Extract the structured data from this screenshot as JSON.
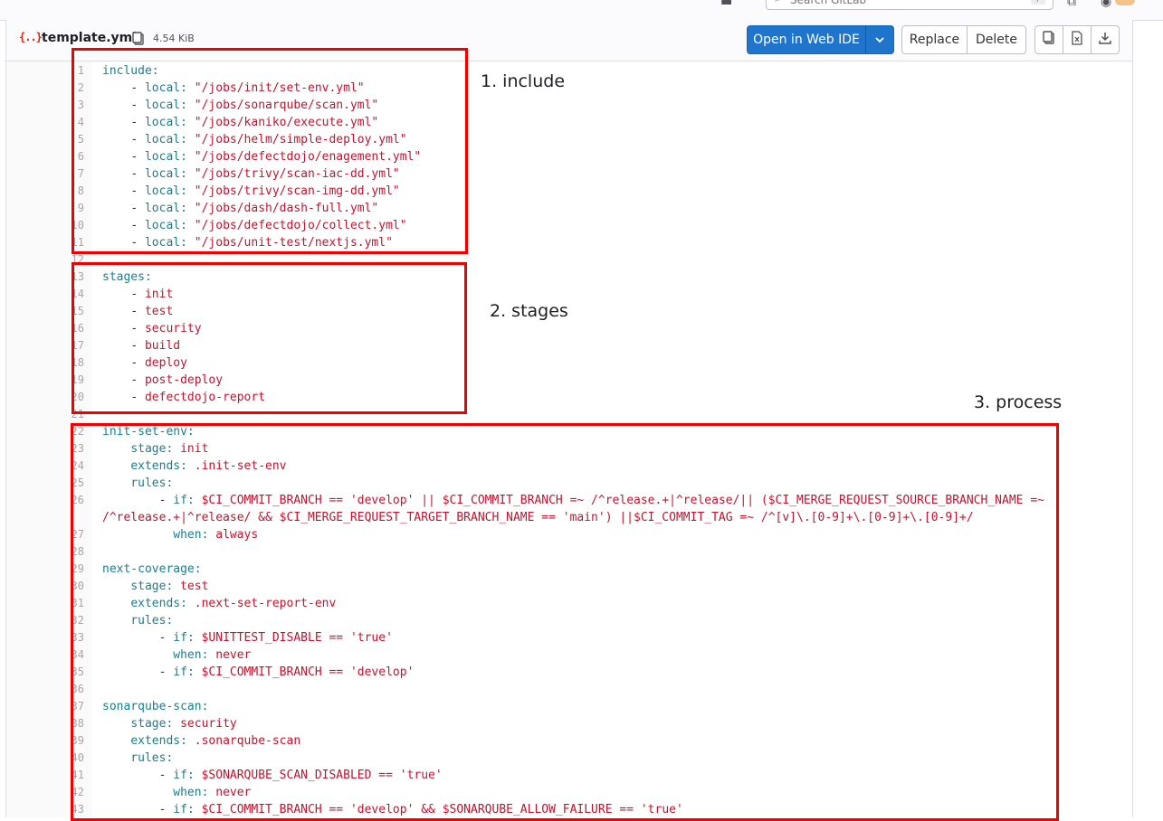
{
  "topbar": {
    "search_placeholder": "Search GitLab",
    "search_kbd": "/"
  },
  "file": {
    "name": "template.yml",
    "size": "4.54 KiB",
    "icon": "yaml-file-icon"
  },
  "actions": {
    "open_ide": "Open in Web IDE",
    "replace": "Replace",
    "delete": "Delete",
    "copy_icon": "copy-icon",
    "raw_icon": "file-raw-icon",
    "download_icon": "download-icon"
  },
  "annotations": {
    "include": "1. include",
    "stages": "2. stages",
    "process": "3. process"
  },
  "code_lines": [
    {
      "n": "1",
      "indent": 0,
      "key": "include",
      "sep": ":",
      "value": ""
    },
    {
      "n": "2",
      "indent": 4,
      "prefix": "- ",
      "key": "local",
      "sep": ": ",
      "value": "\"/jobs/init/set-env.yml\""
    },
    {
      "n": "3",
      "indent": 4,
      "prefix": "- ",
      "key": "local",
      "sep": ": ",
      "value": "\"/jobs/sonarqube/scan.yml\""
    },
    {
      "n": "4",
      "indent": 4,
      "prefix": "- ",
      "key": "local",
      "sep": ": ",
      "value": "\"/jobs/kaniko/execute.yml\""
    },
    {
      "n": "5",
      "indent": 4,
      "prefix": "- ",
      "key": "local",
      "sep": ": ",
      "value": "\"/jobs/helm/simple-deploy.yml\""
    },
    {
      "n": "6",
      "indent": 4,
      "prefix": "- ",
      "key": "local",
      "sep": ": ",
      "value": "\"/jobs/defectdojo/enagement.yml\""
    },
    {
      "n": "7",
      "indent": 4,
      "prefix": "- ",
      "key": "local",
      "sep": ": ",
      "value": "\"/jobs/trivy/scan-iac-dd.yml\""
    },
    {
      "n": "8",
      "indent": 4,
      "prefix": "- ",
      "key": "local",
      "sep": ": ",
      "value": "\"/jobs/trivy/scan-img-dd.yml\""
    },
    {
      "n": "9",
      "indent": 4,
      "prefix": "- ",
      "key": "local",
      "sep": ": ",
      "value": "\"/jobs/dash/dash-full.yml\""
    },
    {
      "n": "10",
      "indent": 4,
      "prefix": "- ",
      "key": "local",
      "sep": ": ",
      "value": "\"/jobs/defectdojo/collect.yml\""
    },
    {
      "n": "11",
      "indent": 4,
      "prefix": "- ",
      "key": "local",
      "sep": ": ",
      "value": "\"/jobs/unit-test/nextjs.yml\""
    },
    {
      "n": "12",
      "indent": 0,
      "key": "",
      "sep": "",
      "value": ""
    },
    {
      "n": "13",
      "indent": 0,
      "key": "stages",
      "sep": ":",
      "value": ""
    },
    {
      "n": "14",
      "indent": 4,
      "prefix": "- ",
      "key": "",
      "sep": "",
      "value": "init"
    },
    {
      "n": "15",
      "indent": 4,
      "prefix": "- ",
      "key": "",
      "sep": "",
      "value": "test"
    },
    {
      "n": "16",
      "indent": 4,
      "prefix": "- ",
      "key": "",
      "sep": "",
      "value": "security"
    },
    {
      "n": "17",
      "indent": 4,
      "prefix": "- ",
      "key": "",
      "sep": "",
      "value": "build"
    },
    {
      "n": "18",
      "indent": 4,
      "prefix": "- ",
      "key": "",
      "sep": "",
      "value": "deploy"
    },
    {
      "n": "19",
      "indent": 4,
      "prefix": "- ",
      "key": "",
      "sep": "",
      "value": "post-deploy"
    },
    {
      "n": "20",
      "indent": 4,
      "prefix": "- ",
      "key": "",
      "sep": "",
      "value": "defectdojo-report"
    },
    {
      "n": "21",
      "indent": 0,
      "key": "",
      "sep": "",
      "value": ""
    },
    {
      "n": "22",
      "indent": 0,
      "key": "init-set-env",
      "sep": ":",
      "value": ""
    },
    {
      "n": "23",
      "indent": 4,
      "key": "stage",
      "sep": ": ",
      "value": "init"
    },
    {
      "n": "24",
      "indent": 4,
      "key": "extends",
      "sep": ": ",
      "value": ".init-set-env"
    },
    {
      "n": "25",
      "indent": 4,
      "key": "rules",
      "sep": ":",
      "value": ""
    },
    {
      "n": "26",
      "indent": 8,
      "prefix": "- ",
      "key": "if",
      "sep": ": ",
      "value": "$CI_COMMIT_BRANCH == 'develop' || $CI_COMMIT_BRANCH =~ /^release.+|^release/|| ($CI_MERGE_REQUEST_SOURCE_BRANCH_NAME =~"
    },
    {
      "n": "",
      "indent": 0,
      "key": "",
      "sep": "",
      "value": "/^release.+|^release/ && $CI_MERGE_REQUEST_TARGET_BRANCH_NAME == 'main') ||$CI_COMMIT_TAG =~ /^[v]\\.[0-9]+\\.[0-9]+\\.[0-9]+/"
    },
    {
      "n": "27",
      "indent": 10,
      "key": "when",
      "sep": ": ",
      "value": "always"
    },
    {
      "n": "28",
      "indent": 0,
      "key": "",
      "sep": "",
      "value": ""
    },
    {
      "n": "29",
      "indent": 0,
      "key": "next-coverage",
      "sep": ":",
      "value": ""
    },
    {
      "n": "30",
      "indent": 4,
      "key": "stage",
      "sep": ": ",
      "value": "test"
    },
    {
      "n": "31",
      "indent": 4,
      "key": "extends",
      "sep": ": ",
      "value": ".next-set-report-env"
    },
    {
      "n": "32",
      "indent": 4,
      "key": "rules",
      "sep": ":",
      "value": ""
    },
    {
      "n": "33",
      "indent": 8,
      "prefix": "- ",
      "key": "if",
      "sep": ": ",
      "value": "$UNITTEST_DISABLE == 'true'"
    },
    {
      "n": "34",
      "indent": 10,
      "key": "when",
      "sep": ": ",
      "value": "never"
    },
    {
      "n": "35",
      "indent": 8,
      "prefix": "- ",
      "key": "if",
      "sep": ": ",
      "value": "$CI_COMMIT_BRANCH == 'develop'"
    },
    {
      "n": "36",
      "indent": 0,
      "key": "",
      "sep": "",
      "value": ""
    },
    {
      "n": "37",
      "indent": 0,
      "key": "sonarqube-scan",
      "sep": ":",
      "value": ""
    },
    {
      "n": "38",
      "indent": 4,
      "key": "stage",
      "sep": ": ",
      "value": "security"
    },
    {
      "n": "39",
      "indent": 4,
      "key": "extends",
      "sep": ": ",
      "value": ".sonarqube-scan"
    },
    {
      "n": "40",
      "indent": 4,
      "key": "rules",
      "sep": ":",
      "value": ""
    },
    {
      "n": "41",
      "indent": 8,
      "prefix": "- ",
      "key": "if",
      "sep": ": ",
      "value": "$SONARQUBE_SCAN_DISABLED == 'true'"
    },
    {
      "n": "42",
      "indent": 10,
      "key": "when",
      "sep": ": ",
      "value": "never"
    },
    {
      "n": "43",
      "indent": 8,
      "prefix": "- ",
      "key": "if",
      "sep": ": ",
      "value": "$CI_COMMIT_BRANCH == 'develop' && $SONARQUBE_ALLOW_FAILURE == 'true'"
    }
  ]
}
